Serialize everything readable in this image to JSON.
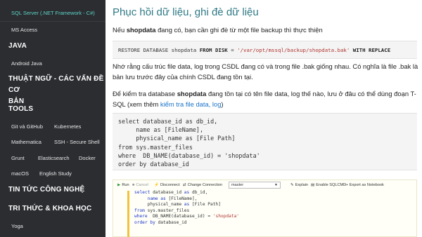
{
  "sidebar": {
    "active_item": "SQL Server (.NET Framework - C#)",
    "item_ms_access": "MS Access",
    "head_java": "JAVA",
    "item_android_java": "Android Java",
    "head_thuat_ngu_1": "THUẬT NGỮ - CÁC VẤN ĐỀ CƠ",
    "head_thuat_ngu_2": "BẢN",
    "head_tools": "TOOLS",
    "item_git": "Git và GitHub",
    "item_kubernetes": "Kubernetes",
    "item_mathematica": "Mathematica",
    "item_ssh": "SSH - Secure Shell",
    "item_grunt": "Grunt",
    "item_elasticsearch": "Elasticsearch",
    "item_docker": "Docker",
    "item_macos": "macOS",
    "item_english": "English Study",
    "head_tin_tuc": "TIN TỨC CÔNG NGHỆ",
    "head_tri_thuc": "TRI THỨC & KHOA HỌC",
    "item_yoga": "Yoga"
  },
  "article": {
    "title": "Phục hồi dữ liệu, ghi đè dữ liệu",
    "p1_before": "Nếu ",
    "p1_bold": "shopdata",
    "p1_after": " đang có, bạn cần ghi đè từ một file backup thì thực thiện",
    "code1_restore": "RESTORE DATABASE shopdata ",
    "code1_from_disk": "FROM DISK",
    "code1_eq": " = ",
    "code1_path": "'/var/opt/mssql/backup/shopdata.bak'",
    "code1_with": " WITH REPLACE",
    "p2": "Nhớ rằng cấu trúc file data, log trong CSDL đang có và trong file .bak giống nhau. Có nghĩa là file .bak là bản lưu trước đây của chính CSDL đang tồn tại.",
    "p3_before": "Để kiểm tra database ",
    "p3_bold": "shopdata",
    "p3_middle": " đang tồn tại có tên file data, log thế nào, lưu ở đâu có thể dùng đoạn T-SQL (xem thêm ",
    "p3_link": "kiểm tra file data, log",
    "p3_after": ")",
    "code2": [
      "select database_id as db_id,",
      "     name as [FileName],",
      "     physical_name as [File Path]",
      "from sys.master_files",
      "where  DB_NAME(database_id) = 'shopdata'",
      "order by database_id"
    ]
  },
  "screenshot": {
    "toolbar": {
      "run": "Run",
      "cancel": "Cancel",
      "disconnect": "Disconnect",
      "change_connection": "Change Connection",
      "database": "master",
      "explain": "Explain",
      "enable_sqlcmd": "Enable SQLCMD",
      "export": "Export as Notebook"
    },
    "sql": [
      "select database_id as db_id,",
      "     name as [FileName],",
      "     physical_name as [File Path]",
      "from sys.master_files",
      "where  DB_NAME(database_id) = 'shopdata'",
      "order by database_id"
    ]
  },
  "colors": {
    "sidebar_bg": "#2b2d31",
    "active_item": "#5fd3c6",
    "title": "#2f7a86",
    "link": "#1a73c9"
  }
}
